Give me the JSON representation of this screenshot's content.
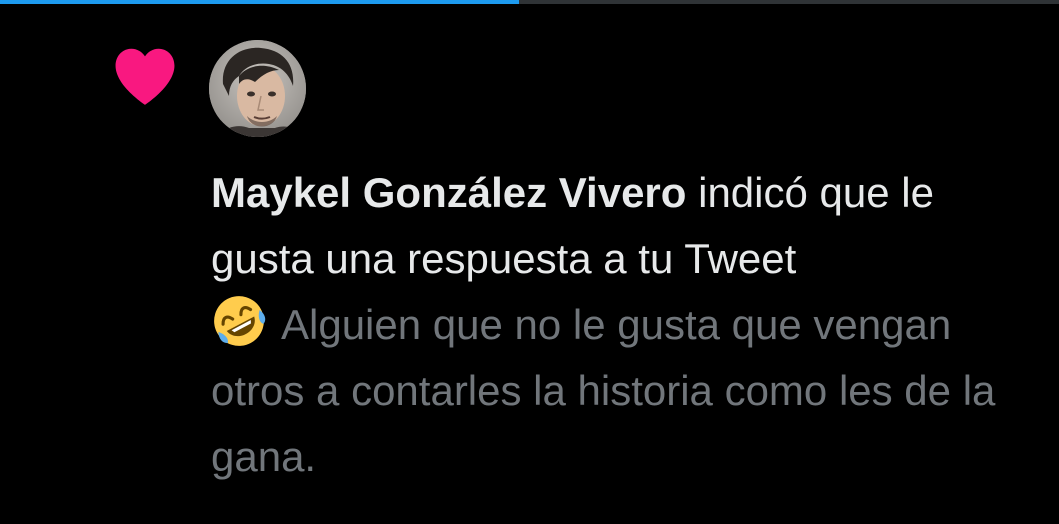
{
  "progress": {
    "fraction": 0.49,
    "fill_color": "#1d9bf0",
    "track_color": "#2f3336"
  },
  "notification": {
    "icon": "heart-icon",
    "icon_color": "#f91880",
    "actor_name": "Maykel González Vivero",
    "action_text": " indicó que le gusta una respuesta a tu Tweet",
    "quote": {
      "emoji": "rolling-on-floor-laughing-icon",
      "text": "Alguien que no le gusta que vengan otros a contarles la historia como les de la gana."
    }
  },
  "colors": {
    "background": "#000000",
    "primary_text": "#e7e9ea",
    "secondary_text": "#71767b"
  }
}
